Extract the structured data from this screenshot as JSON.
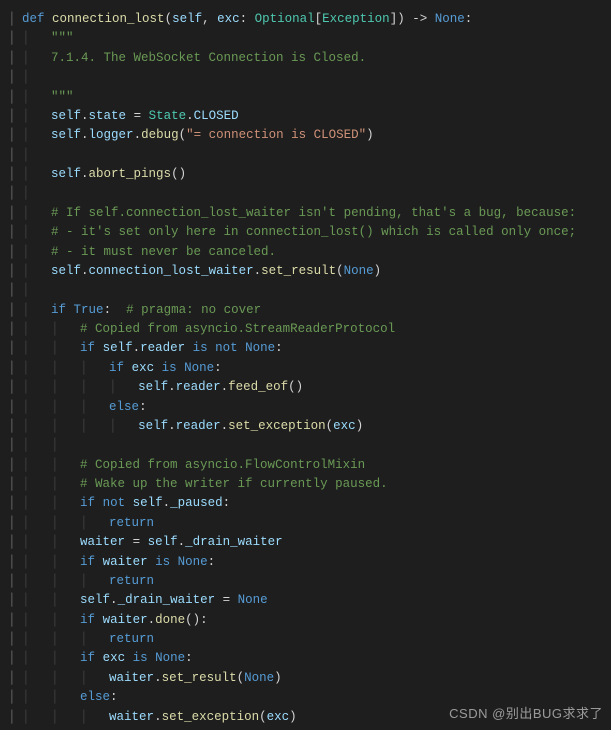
{
  "watermark": "CSDN @别出BUG求求了",
  "code": {
    "fn_def_keyword": "def",
    "fn_name": "connection_lost",
    "param_self": "self",
    "param_exc": "exc",
    "type_optional": "Optional",
    "type_exception": "Exception",
    "ret_none": "None",
    "docq": "\"\"\"",
    "doc_line": "7.1.4. The WebSocket Connection is Closed.",
    "self": "self",
    "state": "state",
    "State": "State",
    "CLOSED": "CLOSED",
    "logger": "logger",
    "debug": "debug",
    "debug_str": "\"= connection is CLOSED\"",
    "abort_pings": "abort_pings",
    "c1": "# If self.connection_lost_waiter isn't pending, that's a bug, because:",
    "c2": "# - it's set only here in connection_lost() which is called only once;",
    "c3": "# - it must never be canceled.",
    "connection_lost_waiter": "connection_lost_waiter",
    "set_result": "set_result",
    "None": "None",
    "if": "if",
    "True": "True",
    "pragma": "# pragma: no cover",
    "c4": "# Copied from asyncio.StreamReaderProtocol",
    "reader": "reader",
    "is_not": "is not",
    "is": "is",
    "exc": "exc",
    "feed_eof": "feed_eof",
    "else": "else",
    "set_exception": "set_exception",
    "c5": "# Copied from asyncio.FlowControlMixin",
    "c6": "# Wake up the writer if currently paused.",
    "not": "not",
    "_paused": "_paused",
    "return": "return",
    "waiter": "waiter",
    "_drain_waiter": "_drain_waiter",
    "done": "done"
  }
}
